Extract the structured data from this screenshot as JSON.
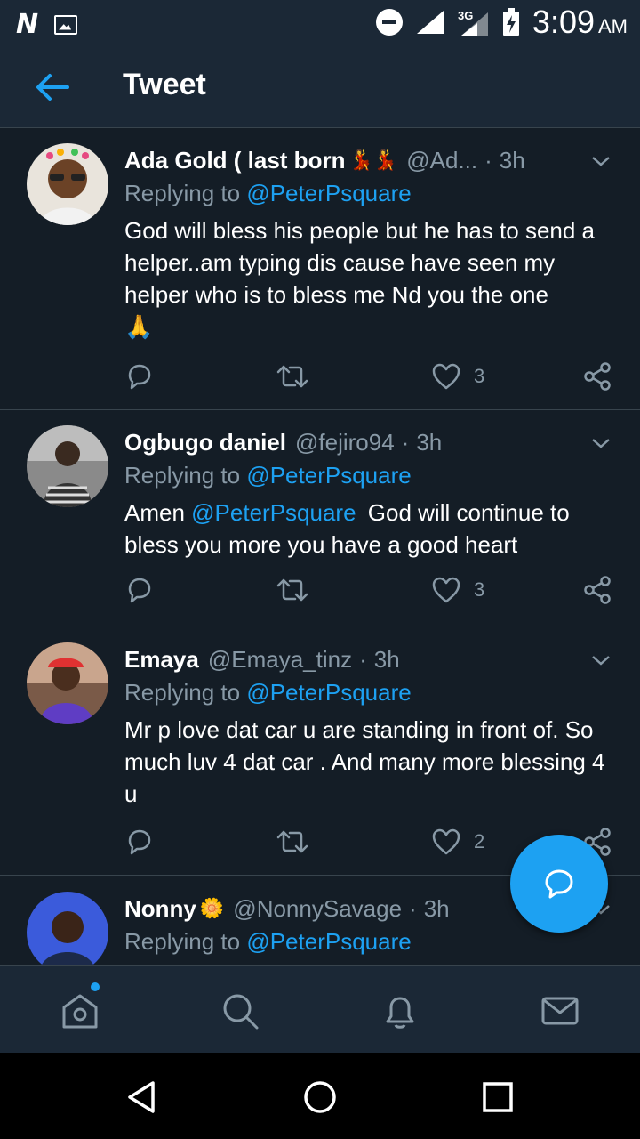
{
  "status_bar": {
    "network_logo": "N",
    "network_type": "3G",
    "time": "3:09",
    "ampm": "AM",
    "icons": [
      "gallery-icon",
      "do-not-disturb-icon",
      "signal-icon",
      "signal-3g-icon",
      "battery-charging-icon"
    ]
  },
  "app_bar": {
    "title": "Tweet",
    "back_icon": "arrow-left-icon"
  },
  "tweets": [
    {
      "name": "Ada Gold ( last born",
      "emoji": "💃💃",
      "handle": "@Ad...",
      "separator": "·",
      "time": "3h",
      "reply_prefix": "Replying to",
      "reply_to": "@PeterPsquare",
      "text": "God will bless his people but he has to send a helper..am typing dis cause have seen my helper who is to bless me Nd you the one",
      "text_emoji": "🙏",
      "likes": "3"
    },
    {
      "name": "Ogbugo daniel",
      "handle": "@fejiro94",
      "separator": "·",
      "time": "3h",
      "reply_prefix": "Replying to",
      "reply_to": "@PeterPsquare",
      "text_prefix": "Amen",
      "text_mention": "@PeterPsquare",
      "text": "God will continue to bless you more you have a good heart",
      "likes": "3"
    },
    {
      "name": "Emaya",
      "handle": "@Emaya_tinz",
      "separator": "·",
      "time": "3h",
      "reply_prefix": "Replying to",
      "reply_to": "@PeterPsquare",
      "text": "Mr p love dat car u are standing in front of. So much luv 4 dat car . And many more blessing 4 u",
      "likes": "2"
    },
    {
      "name": "Nonny",
      "emoji": "🌼",
      "handle": "@NonnySavage",
      "separator": "·",
      "time": "3h",
      "reply_prefix": "Replying to",
      "reply_to": "@PeterPsquare"
    }
  ],
  "colors": {
    "background": "#141d26",
    "bar": "#1b2836",
    "accent": "#1da1f2",
    "muted": "#8899a6",
    "divider": "#38444d"
  },
  "bottom_nav": [
    "home-icon",
    "search-icon",
    "notifications-icon",
    "messages-icon"
  ],
  "system_nav": [
    "back-triangle-icon",
    "home-circle-icon",
    "recents-square-icon"
  ],
  "fab_icon": "reply-bubble-icon"
}
